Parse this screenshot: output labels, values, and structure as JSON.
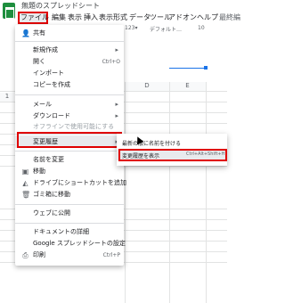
{
  "app": {
    "title": "無題のスプレッドシート"
  },
  "menubar": [
    "ファイル",
    "編集",
    "表示",
    "挿入",
    "表示形式",
    "データ",
    "ツール",
    "アドオン",
    "ヘルプ",
    "最終編"
  ],
  "toolbar": {
    "zoom": "123▾",
    "font": "デフォルト…",
    "size": "10"
  },
  "grid": {
    "columns": [
      "D",
      "E"
    ],
    "row_labels": [
      "1"
    ]
  },
  "file_menu": {
    "share": "共有",
    "new": "新規作成",
    "open": "開く",
    "open_shortcut": "Ctrl+O",
    "import": "インポート",
    "copy": "コピーを作成",
    "email": "メール",
    "download": "ダウンロード",
    "offline": "オフラインで使用可能にする",
    "version_history": "変更履歴",
    "rename": "名前を変更",
    "move": "移動",
    "add_shortcut": "ドライブにショートカットを追加",
    "trash": "ゴミ箱に移動",
    "publish": "ウェブに公開",
    "details": "ドキュメントの詳細",
    "settings": "Google スプレッドシートの設定",
    "print": "印刷",
    "print_shortcut": "Ctrl+P"
  },
  "submenu": {
    "name_current": "最新の版に名前を付ける",
    "show_history": "変更履歴を表示",
    "show_shortcut": "Ctrl+Alt+Shift+H"
  },
  "colors": {
    "accent": "#1a73e8",
    "highlight": "#e00000",
    "brand": "#1e8e3e"
  }
}
